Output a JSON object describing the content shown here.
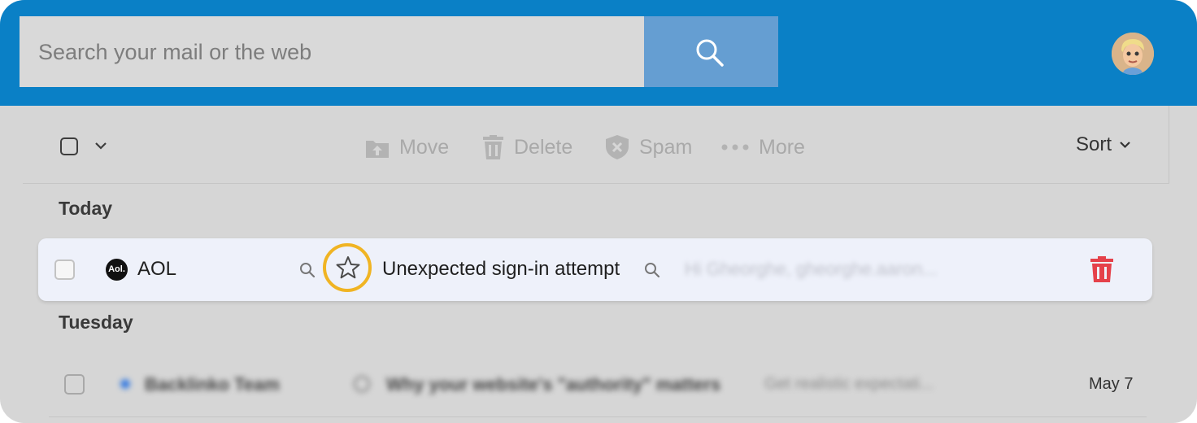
{
  "search": {
    "placeholder": "Search your mail or the web"
  },
  "toolbar": {
    "move_label": "Move",
    "delete_label": "Delete",
    "spam_label": "Spam",
    "more_label": "More",
    "sort_label": "Sort"
  },
  "sections": {
    "today": "Today",
    "tuesday": "Tuesday"
  },
  "emails": [
    {
      "sender": "AOL",
      "subject": "Unexpected sign-in attempt",
      "preview": "Hi Gheorghe, gheorghe.aaron...",
      "highlighted": true
    },
    {
      "sender": "Backlinko Team",
      "subject": "Why your website's \"authority\" matters",
      "preview": "Get realistic expectati...",
      "date": "May 7",
      "unread": true
    }
  ],
  "colors": {
    "header": "#0a80c6",
    "search_button": "#659ed2",
    "highlight_ring": "#f0b423",
    "delete_icon": "#e5414a",
    "row_highlight": "#eef1fa"
  }
}
